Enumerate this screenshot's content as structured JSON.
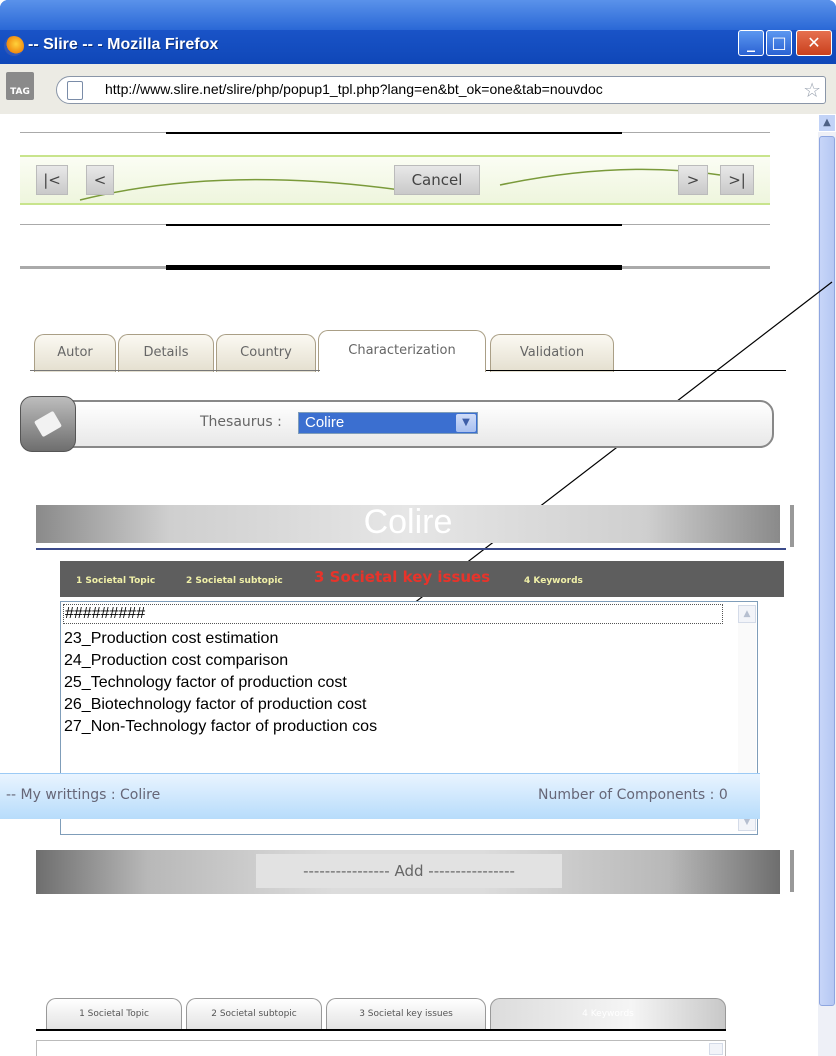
{
  "window": {
    "title": "-- Slire -- - Mozilla Firefox",
    "min_glyph": "_",
    "max_glyph": "□",
    "close_glyph": "✕"
  },
  "address_bar": {
    "tag_label": "TAG",
    "url": "http://www.slire.net/slire/php/popup1_tpl.php?lang=en&bt_ok=one&tab=nouvdoc"
  },
  "nav": {
    "first": "|<",
    "prev": "<",
    "cancel": "Cancel",
    "next": ">",
    "last": ">|"
  },
  "tabs": [
    {
      "label": "Autor"
    },
    {
      "label": "Details"
    },
    {
      "label": "Country"
    },
    {
      "label": "Characterization",
      "active": true
    },
    {
      "label": "Validation"
    }
  ],
  "thesaurus": {
    "label": "Thesaurus :",
    "selected": "Colire"
  },
  "section_title": "Colire",
  "steps": [
    {
      "label": "1 Societal Topic"
    },
    {
      "label": "2 Societal subtopic"
    },
    {
      "label": "3 Societal key issues",
      "active": true
    },
    {
      "label": "4 Keywords"
    }
  ],
  "list": {
    "items": [
      "#########",
      "23_Production cost estimation",
      "24_Production cost comparison",
      "25_Technology factor of production cost",
      "26_Biotechnology factor of production cost",
      "27_Non-Technology factor of production cos"
    ]
  },
  "add_button": "---------------- Add ----------------",
  "my_writings": {
    "label": "-- My writtings : Colire",
    "count_label": "Number of Components : 0"
  },
  "bottom_tabs": [
    {
      "label": "1 Societal Topic"
    },
    {
      "label": "2 Societal subtopic"
    },
    {
      "label": "3 Societal key issues"
    },
    {
      "label": "4 Keywords",
      "active": true
    }
  ]
}
